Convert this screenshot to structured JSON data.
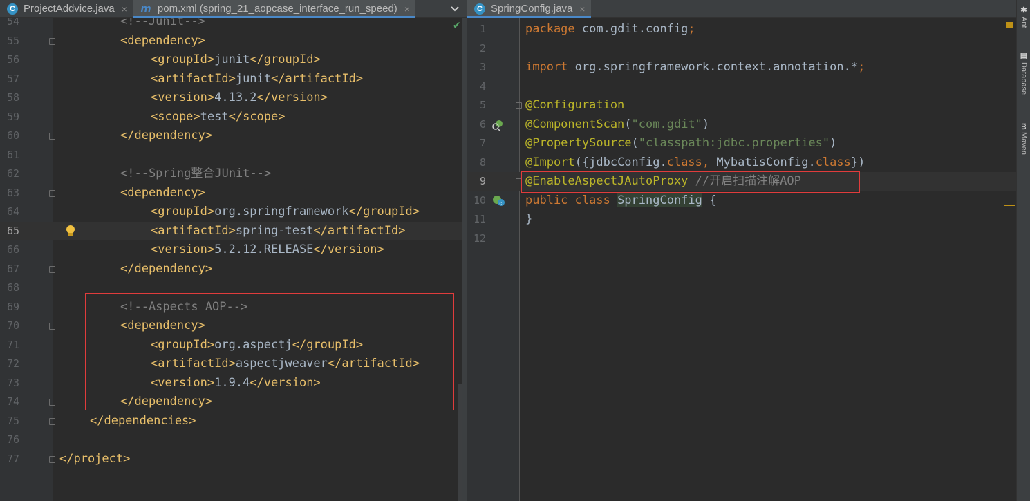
{
  "left_tabs": [
    {
      "label": "ProjectAddvice.java",
      "icon": "c-class-icon"
    },
    {
      "label": "pom.xml (spring_21_aopcase_interface_run_speed)",
      "icon": "maven-icon",
      "active": true
    }
  ],
  "right_tabs": [
    {
      "label": "SpringConfig.java",
      "icon": "c-class-icon",
      "active": true
    }
  ],
  "close_glyph": "×",
  "tab_menu_glyph": "⌄",
  "left_editor": {
    "lines": [
      {
        "n": "54",
        "html": "<span class='cmt'>&lt;!--Junit--&gt;</span>",
        "indent": 2
      },
      {
        "n": "55",
        "html": "<span class='tag'>&lt;dependency&gt;</span>",
        "indent": 2
      },
      {
        "n": "56",
        "html": "<span class='tag'>&lt;groupId&gt;</span><span class='txt'>junit</span><span class='tag'>&lt;/groupId&gt;</span>",
        "indent": 3
      },
      {
        "n": "57",
        "html": "<span class='tag'>&lt;artifactId&gt;</span><span class='txt'>junit</span><span class='tag'>&lt;/artifactId&gt;</span>",
        "indent": 3
      },
      {
        "n": "58",
        "html": "<span class='tag'>&lt;version&gt;</span><span class='txt'>4.13.2</span><span class='tag'>&lt;/version&gt;</span>",
        "indent": 3
      },
      {
        "n": "59",
        "html": "<span class='tag'>&lt;scope&gt;</span><span class='txt'>test</span><span class='tag'>&lt;/scope&gt;</span>",
        "indent": 3
      },
      {
        "n": "60",
        "html": "<span class='tag'>&lt;/dependency&gt;</span>",
        "indent": 2
      },
      {
        "n": "61",
        "html": "",
        "indent": 0
      },
      {
        "n": "62",
        "html": "<span class='cmt'>&lt;!--Spring整合JUnit--&gt;</span>",
        "indent": 2
      },
      {
        "n": "63",
        "html": "<span class='tag'>&lt;dependency&gt;</span>",
        "indent": 2
      },
      {
        "n": "64",
        "html": "<span class='tag'>&lt;groupId&gt;</span><span class='txt'>org.springframework</span><span class='tag'>&lt;/groupId&gt;</span>",
        "indent": 3
      },
      {
        "n": "65",
        "html": "<span class='tag'>&lt;artifactId&gt;</span><span class='txt'>spring-test</span><span class='tag'>&lt;/artifactId&gt;</span>",
        "indent": 3,
        "current": true
      },
      {
        "n": "66",
        "html": "<span class='tag'>&lt;version&gt;</span><span class='txt'>5.2.12.RELEASE</span><span class='tag'>&lt;/version&gt;</span>",
        "indent": 3
      },
      {
        "n": "67",
        "html": "<span class='tag'>&lt;/dependency&gt;</span>",
        "indent": 2
      },
      {
        "n": "68",
        "html": "",
        "indent": 0
      },
      {
        "n": "69",
        "html": "<span class='cmt'>&lt;!--Aspects AOP--&gt;</span>",
        "indent": 2
      },
      {
        "n": "70",
        "html": "<span class='tag'>&lt;dependency&gt;</span>",
        "indent": 2
      },
      {
        "n": "71",
        "html": "<span class='tag'>&lt;groupId&gt;</span><span class='txt'>org.aspectj</span><span class='tag'>&lt;/groupId&gt;</span>",
        "indent": 3
      },
      {
        "n": "72",
        "html": "<span class='tag'>&lt;artifactId&gt;</span><span class='txt'>aspectjweaver</span><span class='tag'>&lt;/artifactId&gt;</span>",
        "indent": 3
      },
      {
        "n": "73",
        "html": "<span class='tag'>&lt;version&gt;</span><span class='txt'>1.9.4</span><span class='tag'>&lt;/version&gt;</span>",
        "indent": 3
      },
      {
        "n": "74",
        "html": "<span class='tag'>&lt;/dependency&gt;</span>",
        "indent": 2
      },
      {
        "n": "75",
        "html": "<span class='tag'>&lt;/dependencies&gt;</span>",
        "indent": 1
      },
      {
        "n": "76",
        "html": "",
        "indent": 0
      },
      {
        "n": "77",
        "html": "<span class='tag'>&lt;/project&gt;</span>",
        "indent": 0
      }
    ]
  },
  "right_editor": {
    "lines": [
      {
        "n": "1",
        "html": "<span class='kw'>package </span><span class='plain'>com.gdit.config</span><span class='kw'>;</span>"
      },
      {
        "n": "2",
        "html": ""
      },
      {
        "n": "3",
        "html": "<span class='kw'>import </span><span class='plain'>org.springframework.context.annotation.*</span><span class='kw'>;</span>"
      },
      {
        "n": "4",
        "html": ""
      },
      {
        "n": "5",
        "html": "<span class='ann'>@Configuration</span>"
      },
      {
        "n": "6",
        "html": "<span class='ann'>@ComponentScan</span><span class='plain'>(</span><span class='str'>\"com.gdit\"</span><span class='plain'>)</span>"
      },
      {
        "n": "7",
        "html": "<span class='ann'>@PropertySource</span><span class='plain'>(</span><span class='str'>\"classpath:jdbc.properties\"</span><span class='plain'>)</span>"
      },
      {
        "n": "8",
        "html": "<span class='ann'>@Import</span><span class='plain'>({jdbcConfig.</span><span class='kw'>class</span><span class='kw'>, </span><span class='plain'>MybatisConfig.</span><span class='kw'>class</span><span class='plain'>})</span>"
      },
      {
        "n": "9",
        "html": "<span class='ann'>@EnableAspectJAutoProxy </span><span class='cmt'>//开启扫描注解AOP</span>",
        "current": true
      },
      {
        "n": "10",
        "html": "<span class='kw'>public class </span><span class='plain cls-hl'>SpringConfig</span><span class='plain'> {</span>"
      },
      {
        "n": "11",
        "html": "<span class='plain'>}</span>"
      },
      {
        "n": "12",
        "html": ""
      }
    ]
  },
  "tool_windows": [
    {
      "label": "Ant",
      "icon": "ant-icon"
    },
    {
      "label": "Database",
      "icon": "database-icon"
    },
    {
      "label": "Maven",
      "icon": "maven-icon"
    }
  ],
  "colors": {
    "background": "#2b2b2b",
    "tag": "#e8bf6a",
    "keyword": "#cc7832",
    "annotation": "#bbb529",
    "string": "#6a8759",
    "comment": "#808080",
    "highlight_box": "#e03c3c",
    "accent": "#4a88c7"
  }
}
